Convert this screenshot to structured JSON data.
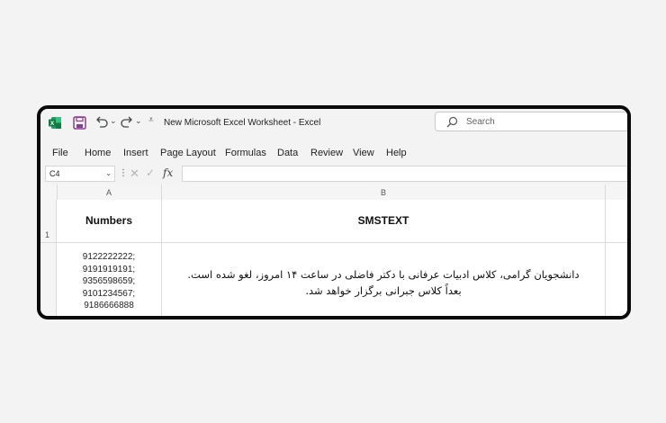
{
  "window": {
    "title": "New Microsoft Excel Worksheet  -  Excel",
    "search_placeholder": "Search"
  },
  "icons": {
    "app": "excel-logo-icon",
    "save": "save-icon",
    "undo": "undo-icon",
    "redo": "redo-icon",
    "search": "search-icon"
  },
  "colors": {
    "excel_green": "#107c41",
    "save_purple": "#8a3e91"
  },
  "menu": [
    "File",
    "Home",
    "Insert",
    "Page Layout",
    "Formulas",
    "Data",
    "Review",
    "View",
    "Help"
  ],
  "formula_bar": {
    "cell_ref": "C4",
    "fx_label": "fx",
    "value": ""
  },
  "grid": {
    "columns": [
      "A",
      "B"
    ],
    "rows": [
      "1"
    ],
    "header_row": [
      "Numbers",
      "SMSTEXT"
    ],
    "numbers": [
      "9122222222;",
      "9191919191;",
      "9356598659;",
      "9101234567;",
      "9186666888"
    ],
    "message": "دانشجویان گرامی، کلاس ادبیات عرفانی با دکتر فاضلی در ساعت ۱۴ امروز، لغو شده است. بعداً کلاس جبرانی برگزار خواهد شد."
  }
}
